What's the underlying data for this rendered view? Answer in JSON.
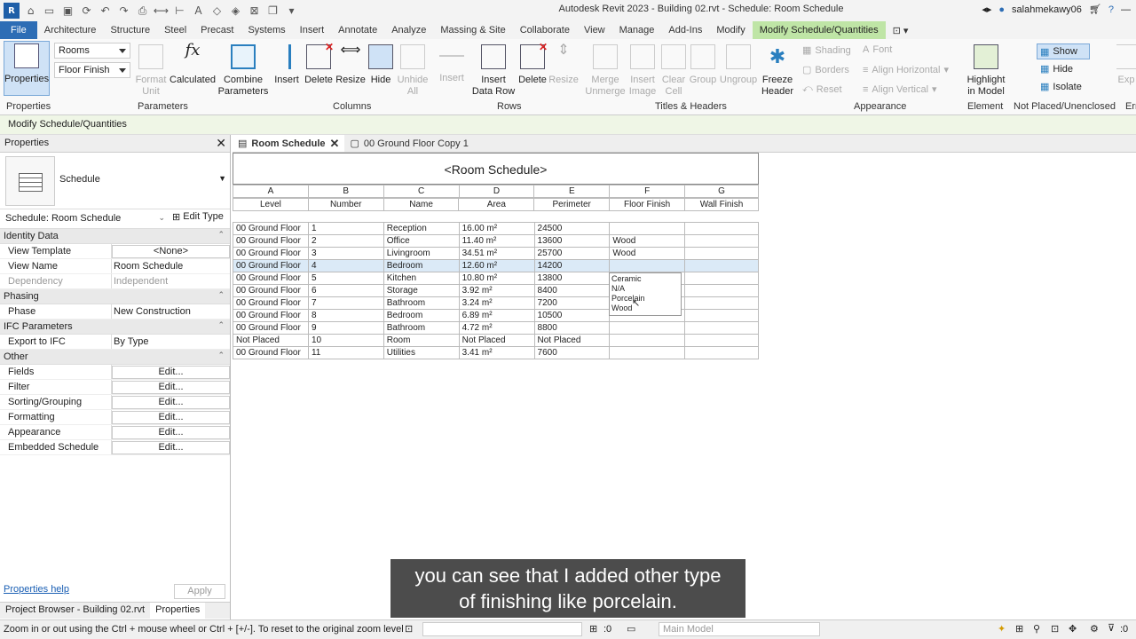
{
  "title_bar": {
    "app_title": "Autodesk Revit 2023 - Building 02.rvt - Schedule: Room Schedule",
    "username": "salahmekawy06"
  },
  "menu_tabs": [
    "File",
    "Architecture",
    "Structure",
    "Steel",
    "Precast",
    "Systems",
    "Insert",
    "Annotate",
    "Analyze",
    "Massing & Site",
    "Collaborate",
    "View",
    "Manage",
    "Add-Ins",
    "Modify",
    "Modify Schedule/Quantities"
  ],
  "ribbon": {
    "properties_label": "Properties",
    "combo1": "Rooms",
    "combo2": "Floor Finish",
    "format_unit": "Format\nUnit",
    "calculated": "Calculated",
    "combine_parameters": "Combine\nParameters",
    "insert": "Insert",
    "delete": "Delete",
    "resize": "Resize",
    "hide": "Hide",
    "unhide_all": "Unhide\nAll",
    "insert_rows": "Insert",
    "insert_data_row": "Insert\nData Row",
    "delete_rows": "Delete",
    "resize_rows": "Resize",
    "merge_unmerge": "Merge\nUnmerge",
    "insert_image": "Insert\nImage",
    "clear_cell": "Clear\nCell",
    "group": "Group",
    "ungroup": "Ungroup",
    "freeze_header": "Freeze\nHeader",
    "shading": "Shading",
    "font": "Font",
    "borders": "Borders",
    "align_horizontal": "Align  Horizontal",
    "reset": "Reset",
    "align_vertical": "Align  Vertical",
    "highlight_in_model": "Highlight\nin Model",
    "show": "Show",
    "hide_el": "Hide",
    "isolate": "Isolate",
    "exp": "Exp",
    "panels": [
      "Properties",
      "Parameters",
      "Columns",
      "Rows",
      "Titles & Headers",
      "Appearance",
      "Element",
      "Not Placed/Unenclosed",
      "Err"
    ]
  },
  "options_bar": "Modify Schedule/Quantities",
  "properties_palette": {
    "title": "Properties",
    "type_name": "Schedule",
    "selector": "Schedule: Room Schedule",
    "edit_type": "Edit Type",
    "groups": [
      {
        "name": "Identity Data",
        "rows": [
          {
            "k": "View Template",
            "v": "<None>",
            "edit": true
          },
          {
            "k": "View Name",
            "v": "Room Schedule",
            "edit": false
          },
          {
            "k": "Dependency",
            "v": "Independent",
            "edit": false,
            "dim": true
          }
        ]
      },
      {
        "name": "Phasing",
        "rows": [
          {
            "k": "Phase",
            "v": "New Construction",
            "edit": false
          }
        ]
      },
      {
        "name": "IFC Parameters",
        "rows": [
          {
            "k": "Export to IFC",
            "v": "By Type",
            "edit": false
          }
        ]
      },
      {
        "name": "Other",
        "rows": [
          {
            "k": "Fields",
            "v": "Edit...",
            "edit": true
          },
          {
            "k": "Filter",
            "v": "Edit...",
            "edit": true
          },
          {
            "k": "Sorting/Grouping",
            "v": "Edit...",
            "edit": true
          },
          {
            "k": "Formatting",
            "v": "Edit...",
            "edit": true
          },
          {
            "k": "Appearance",
            "v": "Edit...",
            "edit": true
          },
          {
            "k": "Embedded Schedule",
            "v": "Edit...",
            "edit": true
          }
        ]
      }
    ],
    "help": "Properties help",
    "apply": "Apply",
    "bottom_tabs": [
      "Project Browser - Building 02.rvt",
      "Properties"
    ]
  },
  "doc_tabs": [
    {
      "label": "Room Schedule",
      "active": true
    },
    {
      "label": "00 Ground Floor Copy 1",
      "active": false
    }
  ],
  "schedule": {
    "title": "<Room Schedule>",
    "letters": [
      "A",
      "B",
      "C",
      "D",
      "E",
      "F",
      "G"
    ],
    "headers": [
      "Level",
      "Number",
      "Name",
      "Area",
      "Perimeter",
      "Floor Finish",
      "Wall Finish"
    ],
    "rows": [
      [
        "00 Ground Floor",
        "1",
        "Reception",
        "16.00 m²",
        "24500",
        "",
        ""
      ],
      [
        "00 Ground Floor",
        "2",
        "Office",
        "11.40 m²",
        "13600",
        "Wood",
        ""
      ],
      [
        "00 Ground Floor",
        "3",
        "Livingroom",
        "34.51 m²",
        "25700",
        "Wood",
        ""
      ],
      [
        "00 Ground Floor",
        "4",
        "Bedroom",
        "12.60 m²",
        "14200",
        "",
        ""
      ],
      [
        "00 Ground Floor",
        "5",
        "Kitchen",
        "10.80 m²",
        "13800",
        "",
        ""
      ],
      [
        "00 Ground Floor",
        "6",
        "Storage",
        "3.92 m²",
        "8400",
        "",
        ""
      ],
      [
        "00 Ground Floor",
        "7",
        "Bathroom",
        "3.24 m²",
        "7200",
        "",
        ""
      ],
      [
        "00 Ground Floor",
        "8",
        "Bedroom",
        "6.89 m²",
        "10500",
        "",
        ""
      ],
      [
        "00 Ground Floor",
        "9",
        "Bathroom",
        "4.72 m²",
        "8800",
        "",
        ""
      ],
      [
        "Not Placed",
        "10",
        "Room",
        "Not Placed",
        "Not Placed",
        "",
        ""
      ],
      [
        "00 Ground Floor",
        "11",
        "Utilities",
        "3.41 m²",
        "7600",
        "",
        ""
      ]
    ],
    "selected_row": 3,
    "dropdown_options": [
      "Ceramic",
      "N/A",
      "Porcelain",
      "Wood"
    ]
  },
  "status_bar": {
    "message": "Zoom in or out using the Ctrl + mouse wheel or Ctrl + [+/-]. To reset to the original zoom level (",
    "zero": ":0",
    "model": "Main Model",
    "filter_count": ":0"
  },
  "subtitle": [
    "you can see that I added other type",
    "of finishing like porcelain."
  ],
  "colors": {
    "file_tab": "#2d6db5",
    "context_tab": "#bfe5a6",
    "selected_row": "#dbeaf7"
  }
}
